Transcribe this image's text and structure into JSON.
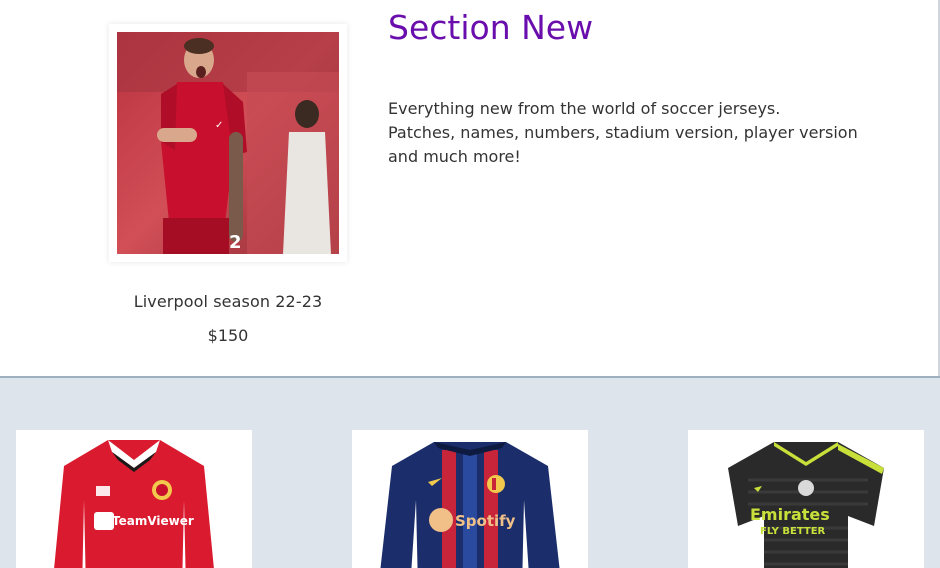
{
  "featured": {
    "name": "Liverpool season 22-23",
    "price": "$150",
    "image_icon": "player-celebration-photo"
  },
  "section": {
    "title": "Section New",
    "description_lines": [
      "Everything new from the world of soccer jerseys.",
      "Patches, names, numbers, stadium version, player version",
      "and much more!"
    ]
  },
  "products": [
    {
      "icon": "man-united-jersey",
      "sponsor": "TeamViewer"
    },
    {
      "icon": "barcelona-jersey",
      "sponsor": "Spotify"
    },
    {
      "icon": "real-madrid-jersey",
      "sponsor": "Emirates",
      "sponsor_sub": "FLY BETTER"
    }
  ],
  "colors": {
    "title": "#6a0dad",
    "bottom_bg": "#dde4ec",
    "liverpool_red": "#c8102e",
    "man_united_red": "#da1a2e",
    "barca_blue": "#1b2e6b",
    "barca_red": "#c8243a",
    "madrid_black": "#2a2a2a",
    "madrid_lime": "#c9e03a"
  }
}
